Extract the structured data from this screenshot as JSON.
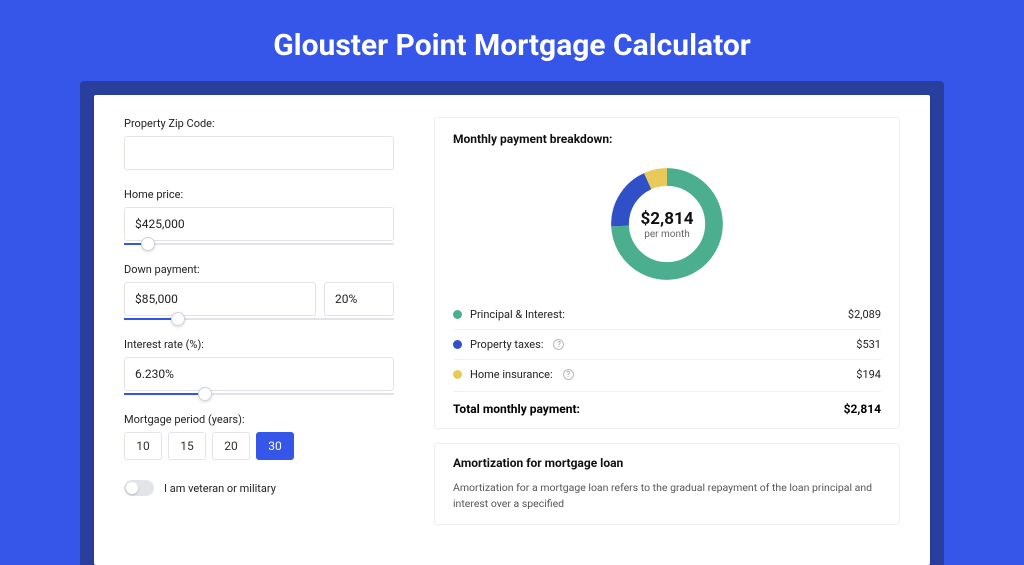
{
  "hero_title": "Glouster Point Mortgage Calculator",
  "form": {
    "zip_label": "Property Zip Code:",
    "zip_value": "",
    "price_label": "Home price:",
    "price_value": "$425,000",
    "price_slider_pct": 9,
    "down_label": "Down payment:",
    "down_value": "$85,000",
    "down_pct_value": "20%",
    "down_slider_pct": 20,
    "rate_label": "Interest rate (%):",
    "rate_value": "6.230%",
    "rate_slider_pct": 30,
    "period_label": "Mortgage period (years):",
    "periods": [
      "10",
      "15",
      "20",
      "30"
    ],
    "period_active": "30",
    "veteran_label": "I am veteran or military"
  },
  "breakdown": {
    "title": "Monthly payment breakdown:",
    "center_value": "$2,814",
    "center_sub": "per month",
    "rows": [
      {
        "label": "Principal & Interest:",
        "value": "$2,089",
        "color": "green",
        "info": false
      },
      {
        "label": "Property taxes:",
        "value": "$531",
        "color": "blue",
        "info": true
      },
      {
        "label": "Home insurance:",
        "value": "$194",
        "color": "yellow",
        "info": true
      }
    ],
    "total_label": "Total monthly payment:",
    "total_value": "$2,814"
  },
  "amort": {
    "title": "Amortization for mortgage loan",
    "text": "Amortization for a mortgage loan refers to the gradual repayment of the loan principal and interest over a specified"
  },
  "chart_data": {
    "type": "pie",
    "title": "Monthly payment breakdown",
    "series": [
      {
        "name": "Principal & Interest",
        "value": 2089,
        "color": "#4baf8f"
      },
      {
        "name": "Property taxes",
        "value": 531,
        "color": "#3050c8"
      },
      {
        "name": "Home insurance",
        "value": 194,
        "color": "#e8c95a"
      }
    ],
    "total": 2814,
    "unit": "USD per month"
  }
}
